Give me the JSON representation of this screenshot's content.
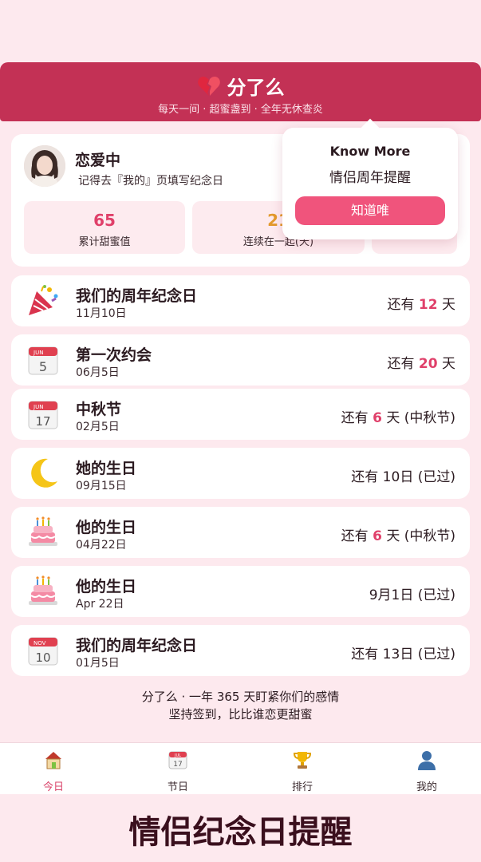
{
  "header": {
    "title": "分了么",
    "subtitle": "每天一间 · 超蜜盏到 · 全年无休查炎",
    "icon": "broken-heart-icon"
  },
  "profile": {
    "status": "恋爱中",
    "hint": "记得去『我的』页填写纪念日",
    "stats": [
      {
        "value": "65",
        "label": "累计甜蜜值",
        "color": "#e0406a"
      },
      {
        "value": "21",
        "label": "连续在一起(天)",
        "color": "#e39a2c"
      },
      {
        "value": "",
        "label": "",
        "color": "#e0406a"
      }
    ]
  },
  "popover": {
    "title": "Know More",
    "body": "情侣周年提醒",
    "button": "知道唯"
  },
  "events": [
    {
      "icon": "party-popper-icon",
      "title": "我们的周年纪念日",
      "date": "11月10日",
      "pre": "还有 ",
      "num": "12",
      "post": " 天"
    },
    {
      "icon": "calendar-5-icon",
      "title": "第一次约会",
      "date": "06月5日",
      "pre": "还有 ",
      "num": "20",
      "post": " 天"
    },
    {
      "icon": "calendar-17-icon",
      "title": "中秋节",
      "date": "02月5日",
      "pre": "还有 ",
      "num": "6",
      "post": " 天 (中秋节)"
    },
    {
      "icon": "moon-icon",
      "title": "她的生日",
      "date": "09月15日",
      "pre": "还有 10日 (已过)",
      "num": "",
      "post": ""
    },
    {
      "icon": "cake-icon",
      "title": "他的生日",
      "date": "04月22日",
      "pre": "还有 ",
      "num": "6",
      "post": " 天 (中秋节)"
    },
    {
      "icon": "cake-icon",
      "title": "他的生日",
      "date": "Apr 22日",
      "pre": "9月1日 (已过)",
      "num": "",
      "post": ""
    },
    {
      "icon": "calendar-10-icon",
      "title": "我们的周年纪念日",
      "date": "01月5日",
      "pre": "还有 13日 (已过)",
      "num": "",
      "post": ""
    }
  ],
  "footer": {
    "line1": "分了么 · 一年 365 天盯紧你们的感情",
    "line2": "坚持签到，比比谁恋更甜蜜"
  },
  "tabs": [
    {
      "label": "今日",
      "icon": "home-icon"
    },
    {
      "label": "节日",
      "icon": "calendar-icon"
    },
    {
      "label": "排行",
      "icon": "trophy-icon"
    },
    {
      "label": "我的",
      "icon": "user-icon"
    }
  ],
  "calendar_icon_labels": {
    "jun": "JUN",
    "nov": "NOV",
    "tab_month": "JUL",
    "tab_day": "17",
    "d5": "5",
    "d17": "17",
    "d10": "10"
  },
  "caption": "情侣纪念日提醒",
  "colors": {
    "brand": "#c33155",
    "accent": "#f0547c",
    "highlight": "#e0406a",
    "background": "#fde9ee"
  }
}
